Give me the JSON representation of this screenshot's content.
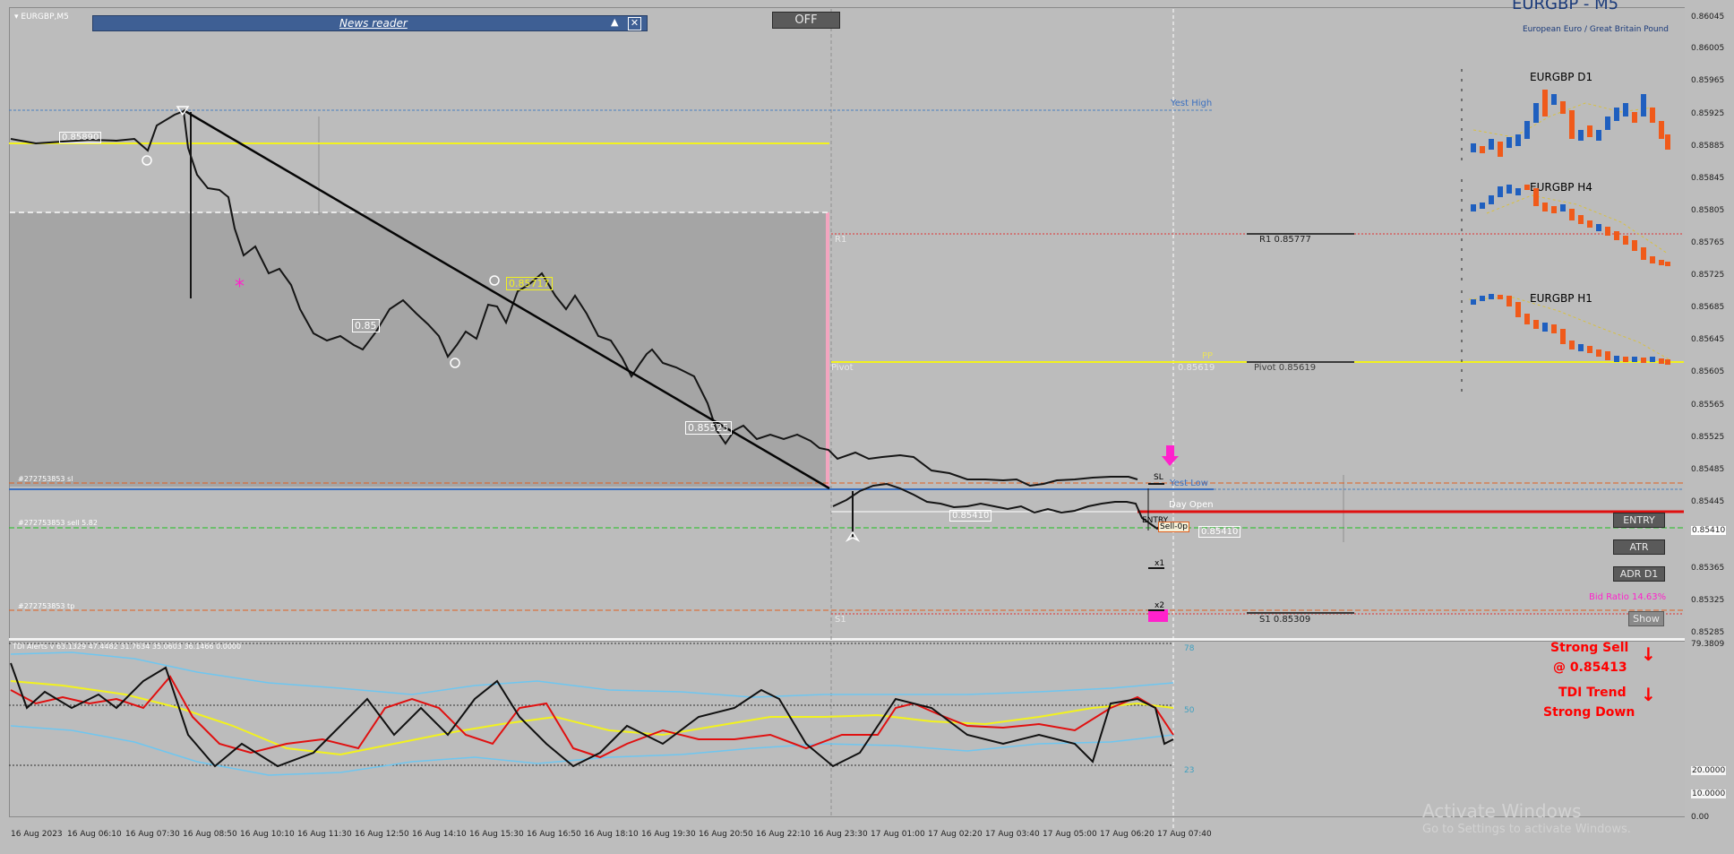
{
  "chart": {
    "symbol_tf": "EURGBP,M5",
    "title": "EURGBP - M5",
    "subtitle": "European Euro / Great Britain Pound"
  },
  "news_reader": {
    "label": "News reader"
  },
  "off_button": "OFF",
  "price_axis": [
    "0.86045",
    "0.86005",
    "0.85965",
    "0.85925",
    "0.85885",
    "0.85845",
    "0.85805",
    "0.85765",
    "0.85725",
    "0.85685",
    "0.85645",
    "0.85605",
    "0.85565",
    "0.85525",
    "0.85485",
    "0.85445",
    "0.85410",
    "0.85365",
    "0.85325",
    "0.85285"
  ],
  "indicator_axis": [
    "79.3809",
    "20.0000",
    "10.0000",
    "0.00"
  ],
  "time_axis": [
    "16 Aug 2023",
    "16 Aug 06:10",
    "16 Aug 07:30",
    "16 Aug 08:50",
    "16 Aug 10:10",
    "16 Aug 11:30",
    "16 Aug 12:50",
    "16 Aug 14:10",
    "16 Aug 15:30",
    "16 Aug 16:50",
    "16 Aug 18:10",
    "16 Aug 19:30",
    "16 Aug 20:50",
    "16 Aug 22:10",
    "16 Aug 23:30",
    "17 Aug 01:00",
    "17 Aug 02:20",
    "17 Aug 03:40",
    "17 Aug 05:00",
    "17 Aug 06:20",
    "17 Aug 07:40"
  ],
  "levels": {
    "yest_high": "Yest High",
    "r1": "R1",
    "r1_value": "R1 0.85777",
    "pivot": "Pivot",
    "pp": "PP",
    "pp_value": "0.85619",
    "pivot_value": "Pivot 0.85619",
    "yest_low": "Yest Low",
    "day_open": "Day Open",
    "s1": "S1",
    "s1_value": "S1 0.85309"
  },
  "order_labels": {
    "sl": "#272753853 sl",
    "sell": "#272753853 sell 5.82",
    "tp": "#272753853 tp"
  },
  "price_tags": {
    "p1": "0.85890",
    "p2": "0.85717",
    "p3": "0.85",
    "p4": "0.85525",
    "p5": "0.85410",
    "p6": "0.85410"
  },
  "markers": {
    "sl": "SL",
    "entry": "ENTRY",
    "sell": "Sell-0p",
    "x1": "x1",
    "x2": "x2"
  },
  "mini_charts": [
    "EURGBP D1",
    "EURGBP H4",
    "EURGBP H1"
  ],
  "side_buttons": {
    "entry": "ENTRY",
    "atr": "ATR",
    "adr": "ADR D1",
    "show": "Show"
  },
  "bid_ratio": "Bid Ratio 14.63%",
  "signals": {
    "strong_sell": "Strong Sell",
    "at_price": "@ 0.85413",
    "tdi_trend": "TDI Trend",
    "strong_down": "Strong Down"
  },
  "indicator": {
    "label": "TDI Alerts v 63.1329 47.4482 31.7634 35.0603 36.1466 0.0000",
    "levels": [
      "78",
      "50",
      "23"
    ]
  },
  "watermark": {
    "title": "Activate Windows",
    "sub": "Go to Settings to activate Windows."
  },
  "colors": {
    "bull": "#1f5fbf",
    "bear": "#f05a1a",
    "signal": "#ff0000",
    "pivot": "#f2f21e",
    "magenta": "#ff22cc"
  }
}
